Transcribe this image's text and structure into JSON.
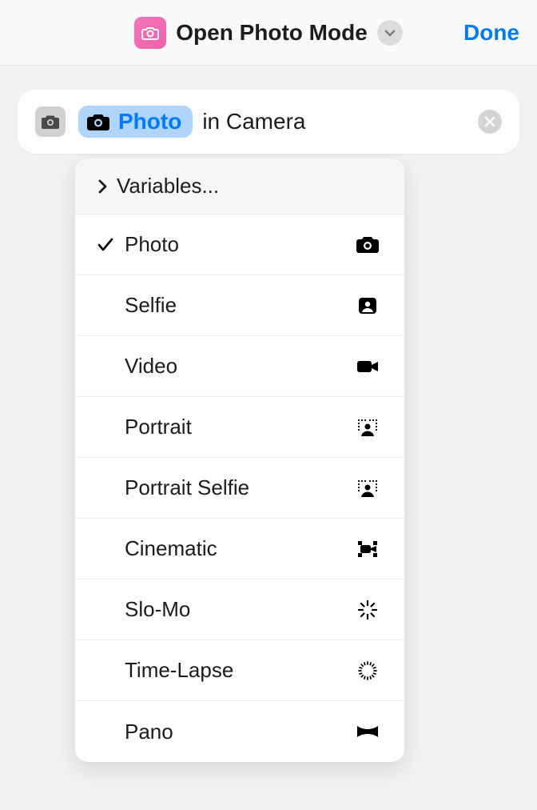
{
  "header": {
    "title": "Open Photo Mode",
    "done_label": "Done"
  },
  "action": {
    "selected_mode": "Photo",
    "suffix_text": "in Camera"
  },
  "dropdown": {
    "variables_label": "Variables...",
    "options": [
      {
        "label": "Photo",
        "icon": "camera",
        "selected": true
      },
      {
        "label": "Selfie",
        "icon": "selfie",
        "selected": false
      },
      {
        "label": "Video",
        "icon": "video",
        "selected": false
      },
      {
        "label": "Portrait",
        "icon": "portrait",
        "selected": false
      },
      {
        "label": "Portrait Selfie",
        "icon": "portrait",
        "selected": false
      },
      {
        "label": "Cinematic",
        "icon": "cinematic",
        "selected": false
      },
      {
        "label": "Slo-Mo",
        "icon": "slomo",
        "selected": false
      },
      {
        "label": "Time-Lapse",
        "icon": "timelapse",
        "selected": false
      },
      {
        "label": "Pano",
        "icon": "pano",
        "selected": false
      }
    ]
  }
}
